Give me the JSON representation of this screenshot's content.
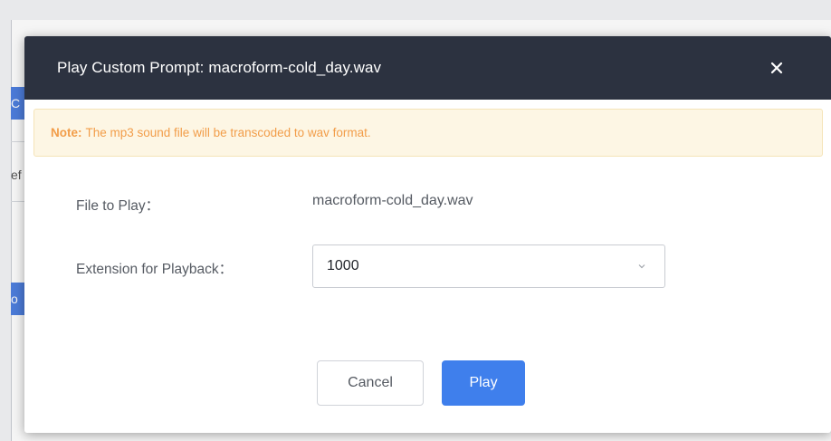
{
  "background": {
    "fragments": [
      "C",
      "ef",
      "o"
    ]
  },
  "dialog": {
    "title": "Play Custom Prompt: macroform-cold_day.wav",
    "close_icon": "close-icon",
    "note": {
      "label": "Note:",
      "text": "The mp3 sound file will be transcoded to wav format."
    },
    "file_to_play": {
      "label": "File to Play：",
      "value": "macroform-cold_day.wav"
    },
    "extension": {
      "label": "Extension for Playback：",
      "selected": "1000",
      "icon": "chevron-down-icon"
    },
    "buttons": {
      "cancel": "Cancel",
      "play": "Play"
    }
  },
  "colors": {
    "header_bg": "#2c3240",
    "accent": "#3f7fec",
    "note_text": "#f29d49",
    "note_bg": "#fdf6e4"
  }
}
